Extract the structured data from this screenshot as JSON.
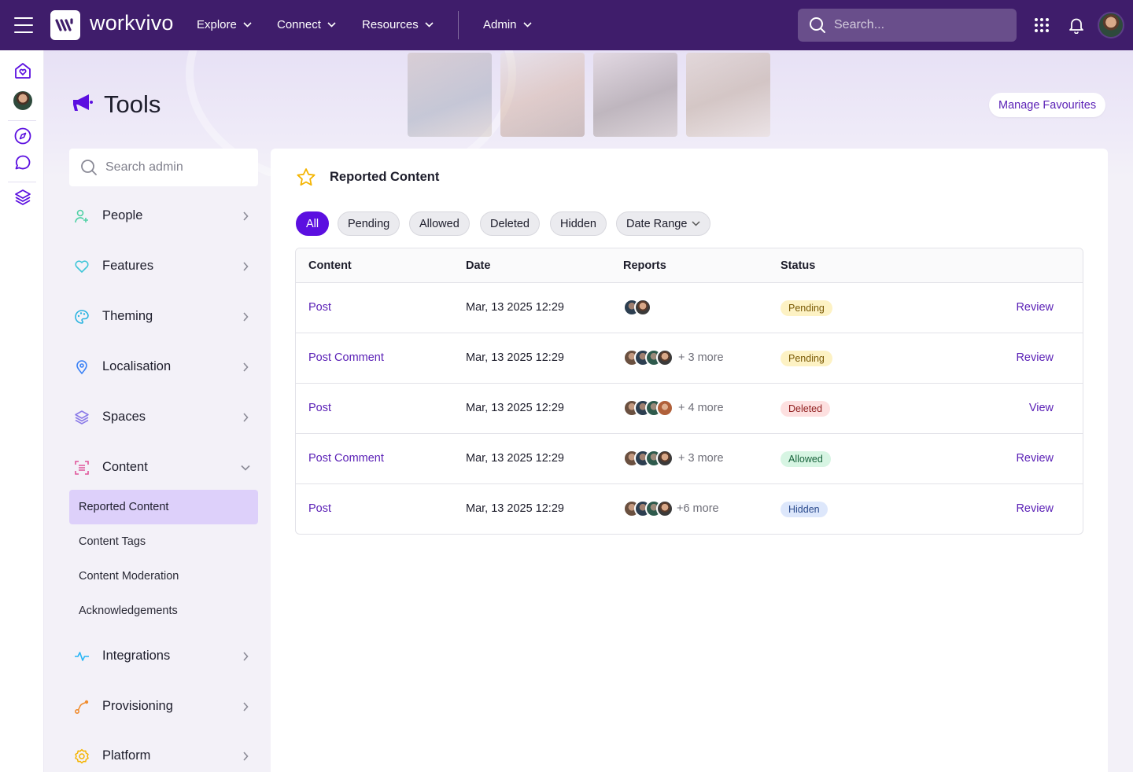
{
  "topbar": {
    "brand": "workvivo",
    "nav": [
      {
        "label": "Explore"
      },
      {
        "label": "Connect"
      },
      {
        "label": "Resources"
      },
      {
        "label": "Admin"
      }
    ],
    "search_placeholder": "Search..."
  },
  "page": {
    "title": "Tools",
    "manage_favourites": "Manage Favourites"
  },
  "admin_nav": {
    "search_placeholder": "Search admin",
    "items": [
      {
        "label": "People",
        "icon": "add-person-icon",
        "color": "#4fd1a5"
      },
      {
        "label": "Features",
        "icon": "heart-icon",
        "color": "#3fc6d8"
      },
      {
        "label": "Theming",
        "icon": "palette-icon",
        "color": "#2bb4e0"
      },
      {
        "label": "Localisation",
        "icon": "map-pin-icon",
        "color": "#3b82f6"
      },
      {
        "label": "Spaces",
        "icon": "layers-icon",
        "color": "#8b7be8"
      },
      {
        "label": "Content",
        "icon": "content-scan-icon",
        "color": "#e0559a",
        "expanded": true
      },
      {
        "label": "Integrations",
        "icon": "activity-icon",
        "color": "#29b6f6"
      },
      {
        "label": "Provisioning",
        "icon": "route-icon",
        "color": "#f08c2e"
      },
      {
        "label": "Platform",
        "icon": "gear-icon",
        "color": "#f4b400"
      }
    ],
    "content_sub": [
      {
        "label": "Reported Content",
        "active": true
      },
      {
        "label": "Content Tags"
      },
      {
        "label": "Content Moderation"
      },
      {
        "label": "Acknowledgements"
      }
    ]
  },
  "reported": {
    "title": "Reported Content",
    "filters": [
      {
        "label": "All",
        "active": true
      },
      {
        "label": "Pending"
      },
      {
        "label": "Allowed"
      },
      {
        "label": "Deleted"
      },
      {
        "label": "Hidden"
      },
      {
        "label": "Date Range",
        "dropdown": true
      }
    ],
    "columns": [
      "Content",
      "Date",
      "Reports",
      "Status"
    ],
    "rows": [
      {
        "content": "Post",
        "date": "Mar, 13 2025 12:29",
        "avatars": 2,
        "more": "",
        "status": "Pending",
        "status_key": "pending",
        "action": "Review"
      },
      {
        "content": "Post Comment",
        "date": "Mar, 13 2025 12:29",
        "avatars": 4,
        "more": "+ 3 more",
        "status": "Pending",
        "status_key": "pending",
        "action": "Review"
      },
      {
        "content": "Post",
        "date": "Mar, 13 2025 12:29",
        "avatars": 4,
        "more": "+ 4 more",
        "status": "Deleted",
        "status_key": "deleted",
        "action": "View"
      },
      {
        "content": "Post Comment",
        "date": "Mar, 13 2025 12:29",
        "avatars": 4,
        "more": "+ 3 more",
        "status": "Allowed",
        "status_key": "allowed",
        "action": "Review"
      },
      {
        "content": "Post",
        "date": "Mar, 13 2025 12:29",
        "avatars": 4,
        "more": "+6 more",
        "status": "Hidden",
        "status_key": "hidden",
        "action": "Review"
      }
    ]
  },
  "colors": {
    "topbar": "#3f1d6b",
    "accent": "#5b0fe0",
    "link": "#5b21b6",
    "active_sub": "#ddd0fa"
  }
}
